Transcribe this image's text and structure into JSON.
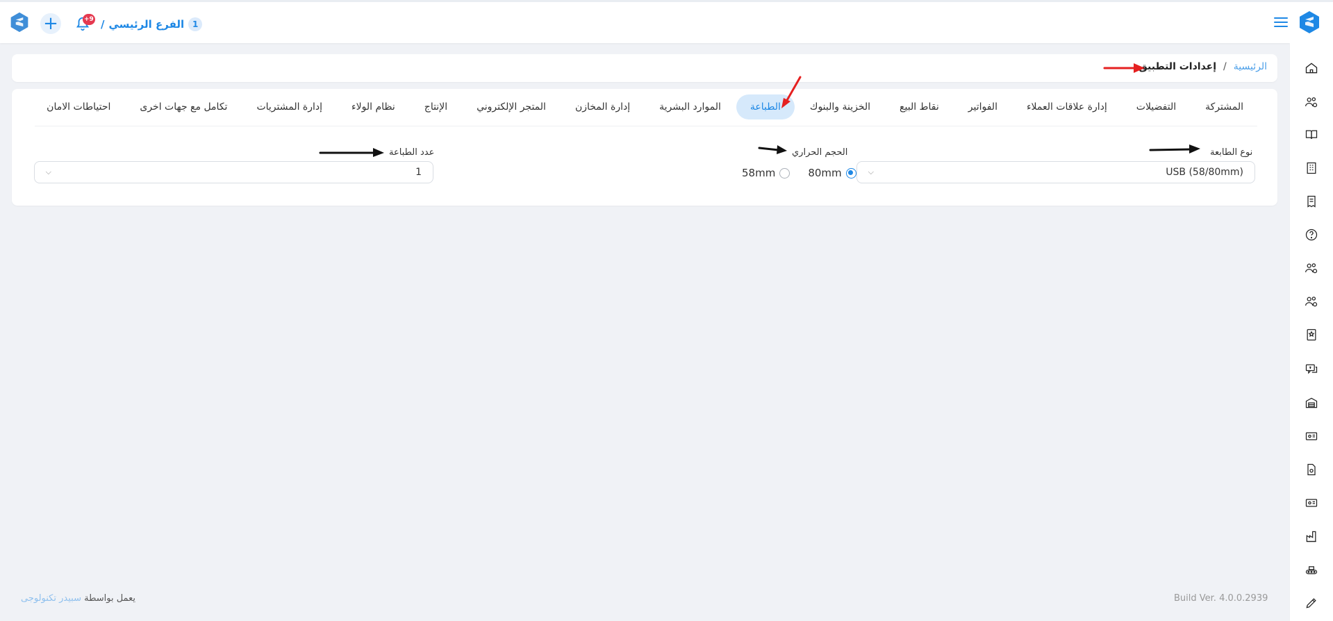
{
  "header": {
    "branch_number": "1",
    "branch_name": "الفرع الرئيسي",
    "branch_separator": "/",
    "notification_count": "+9"
  },
  "breadcrumb": {
    "home": "الرئيسية",
    "separator": "/",
    "current": "إعدادات التطبيق"
  },
  "tabs": [
    {
      "label": "المشتركة",
      "active": false
    },
    {
      "label": "التفضيلات",
      "active": false
    },
    {
      "label": "إدارة علاقات العملاء",
      "active": false
    },
    {
      "label": "الفواتير",
      "active": false
    },
    {
      "label": "نقاط البيع",
      "active": false
    },
    {
      "label": "الخزينة والبنوك",
      "active": false
    },
    {
      "label": "الطباعة",
      "active": true
    },
    {
      "label": "الموارد البشرية",
      "active": false
    },
    {
      "label": "إدارة المخازن",
      "active": false
    },
    {
      "label": "المتجر الإلكتروني",
      "active": false
    },
    {
      "label": "الإنتاج",
      "active": false
    },
    {
      "label": "نظام الولاء",
      "active": false
    },
    {
      "label": "إدارة المشتريات",
      "active": false
    },
    {
      "label": "تكامل مع جهات اخرى",
      "active": false
    },
    {
      "label": "احتياطات الامان",
      "active": false
    }
  ],
  "printer_settings": {
    "printer_type_label": "نوع الطابعة",
    "printer_type_value": "USB (58/80mm)",
    "thermal_size_label": "الحجم الحراري",
    "thermal_options": [
      "80mm",
      "58mm"
    ],
    "thermal_selected": "80mm",
    "printer_count_label": "عدد الطباعة",
    "printer_count_value": "1"
  },
  "footer": {
    "powered_by": "يعمل بواسطة",
    "brand": "سبيدر تكنولوجى",
    "build_version": "Build Ver. 4.0.0.2939"
  },
  "colors": {
    "accent": "#1e88e5",
    "active_tab_bg": "#d6e9fb",
    "badge": "#e53950",
    "page_bg": "#f0f2f6"
  },
  "sidebar_icons": [
    "home-icon",
    "users-gear-icon",
    "book-icon",
    "building-icon",
    "receipt-icon",
    "help-icon",
    "users-gear-icon",
    "users-gear-icon",
    "certificate-icon",
    "money-chat-icon",
    "warehouse-icon",
    "id-card-icon",
    "document-gear-icon",
    "id-card-icon",
    "factory-icon",
    "conveyor-icon",
    "pen-icon"
  ]
}
